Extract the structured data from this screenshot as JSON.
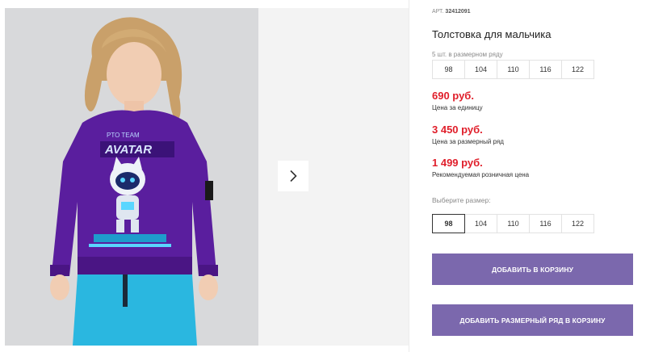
{
  "product": {
    "sku_label": "АРТ.",
    "sku": "32412091",
    "title": "Толстовка для мальчика",
    "print_text_top": "PTO TEAM",
    "print_text_main": "AVATAR"
  },
  "pack": {
    "caption": "5 шт. в размерном ряду",
    "sizes": [
      "98",
      "104",
      "110",
      "116",
      "122"
    ]
  },
  "prices": {
    "unit_price": "690 руб.",
    "unit_label": "Цена за единицу",
    "pack_price": "3 450 руб.",
    "pack_label": "Цена за размерный ряд",
    "retail_price": "1 499 руб.",
    "retail_label": "Рекомендуемая розничная цена"
  },
  "size_select": {
    "label": "Выберите размер:",
    "options": [
      "98",
      "104",
      "110",
      "116",
      "122"
    ],
    "selected": "98"
  },
  "buttons": {
    "add_to_cart": "Добавить в корзину",
    "add_pack_to_cart": "Добавить размерный ряд в корзину"
  },
  "colors": {
    "accent": "#7b68ad",
    "price": "#e01e2a",
    "sweatshirt": "#5a1e9e",
    "pants": "#2ab7e0"
  },
  "icons": {
    "next": "chevron-right-icon"
  }
}
